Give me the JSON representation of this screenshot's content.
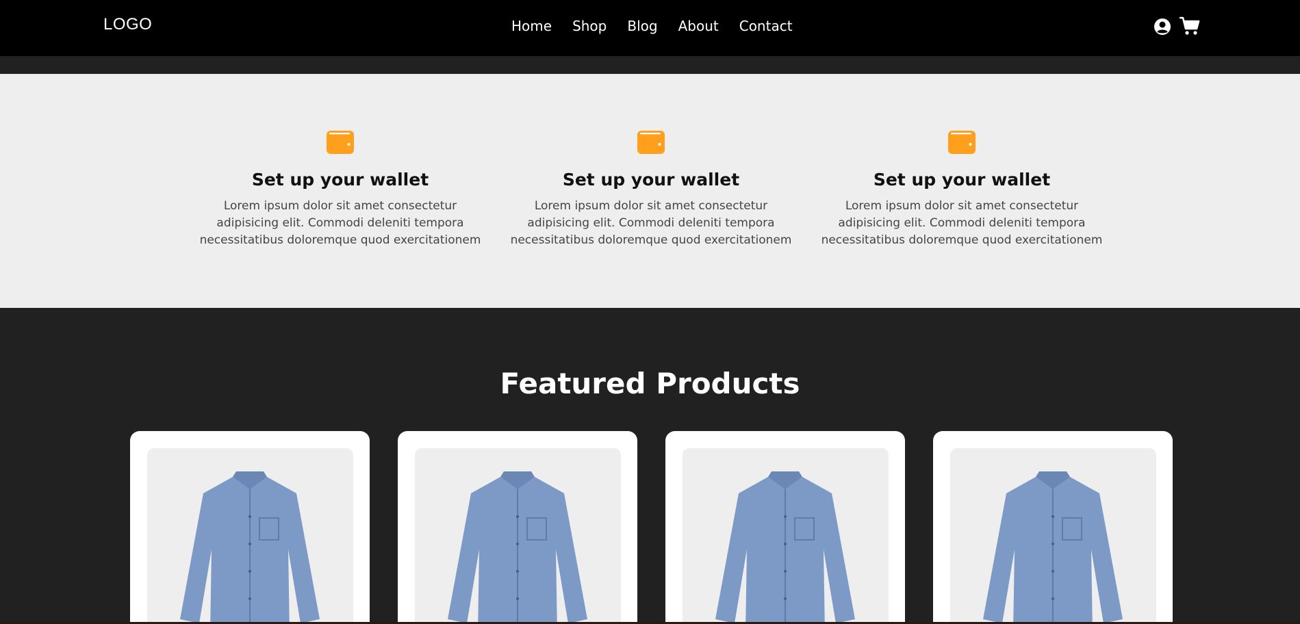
{
  "header": {
    "logo": "LOGO",
    "nav": [
      "Home",
      "Shop",
      "Blog",
      "About",
      "Contact"
    ],
    "icons": [
      "user-icon",
      "cart-icon"
    ]
  },
  "features": [
    {
      "icon": "wallet-icon",
      "title": "Set up your wallet",
      "text": "Lorem ipsum dolor sit amet consectetur adipisicing elit. Commodi deleniti tempora necessitatibus doloremque quod exercitationem"
    },
    {
      "icon": "wallet-icon",
      "title": "Set up your wallet",
      "text": "Lorem ipsum dolor sit amet consectetur adipisicing elit. Commodi deleniti tempora necessitatibus doloremque quod exercitationem"
    },
    {
      "icon": "wallet-icon",
      "title": "Set up your wallet",
      "text": "Lorem ipsum dolor sit amet consectetur adipisicing elit. Commodi deleniti tempora necessitatibus doloremque quod exercitationem"
    }
  ],
  "products": {
    "title": "Featured Products"
  },
  "colors": {
    "accent": "#ff9f1c",
    "header_bg": "#000000",
    "dark_bg": "#212121",
    "light_bg": "#eeeeee",
    "shirt": "#7d99c6"
  }
}
